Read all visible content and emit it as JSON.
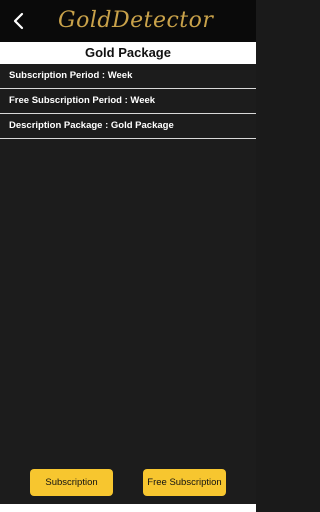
{
  "header": {
    "logo_text": "GoldDetector",
    "back_icon": "arrow-back-icon",
    "title": "Gold Package"
  },
  "details": [
    {
      "label": "Subscription Period",
      "value": "Week",
      "text": "Subscription Period : Week"
    },
    {
      "label": "Free Subscription Period",
      "value": "Week",
      "text": "Free Subscription Period : Week"
    },
    {
      "label": "Description Package",
      "value": "Gold Package",
      "text": "Description Package : Gold Package"
    }
  ],
  "actions": {
    "subscription_label": "Subscription",
    "free_subscription_label": "Free Subscription"
  },
  "colors": {
    "background": "#1c1c1c",
    "topbar": "#0a0a0a",
    "accent_gold": "#c9a24a",
    "button_yellow": "#f7c62f"
  }
}
